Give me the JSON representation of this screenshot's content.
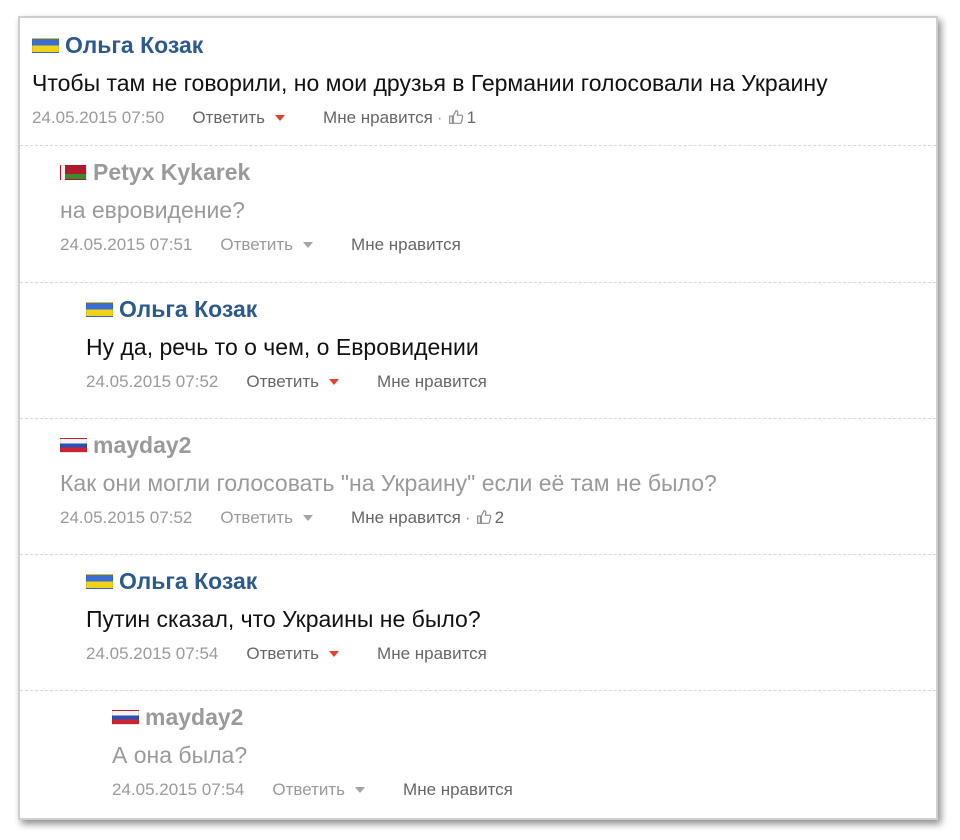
{
  "comments": [
    {
      "flag": "ua",
      "author": "Ольга Козак",
      "text": "Чтобы там не говорили, но мои друзья в Германии голосовали на Украину",
      "date": "24.05.2015 07:50",
      "reply": "Ответить",
      "like": "Мне нравится",
      "like_count": "1",
      "dim": false
    },
    {
      "flag": "by",
      "author": "Petyx Kykarek",
      "text": "на евровидение?",
      "date": "24.05.2015 07:51",
      "reply": "Ответить",
      "like": "Мне нравится",
      "like_count": "",
      "dim": true
    },
    {
      "flag": "ua",
      "author": "Ольга Козак",
      "text": "Ну да, речь то о чем, о Евровидении",
      "date": "24.05.2015 07:52",
      "reply": "Ответить",
      "like": "Мне нравится",
      "like_count": "",
      "dim": false
    },
    {
      "flag": "ru",
      "author": "mayday2",
      "text": "Как они могли голосовать \"на Украину\" если её там не было?",
      "date": "24.05.2015 07:52",
      "reply": "Ответить",
      "like": "Мне нравится",
      "like_count": "2",
      "dim": true
    },
    {
      "flag": "ua",
      "author": "Ольга Козак",
      "text": "Путин сказал, что Украины не было?",
      "date": "24.05.2015 07:54",
      "reply": "Ответить",
      "like": "Мне нравится",
      "like_count": "",
      "dim": false
    },
    {
      "flag": "ru",
      "author": "mayday2",
      "text": "А она была?",
      "date": "24.05.2015 07:54",
      "reply": "Ответить",
      "like": "Мне нравится",
      "like_count": "",
      "dim": true
    }
  ],
  "icons": {
    "flag_ua": "ukraine-flag-icon",
    "flag_by": "belarus-flag-icon",
    "flag_ru": "russia-flag-icon",
    "thumb": "thumbs-up-icon",
    "caret": "chevron-down-icon"
  },
  "colors": {
    "author_active": "#2d5a8c",
    "author_dim": "#9a9a9a",
    "reply_caret_active": "#e0432a",
    "reply_caret_dim": "#a5a5a5"
  }
}
